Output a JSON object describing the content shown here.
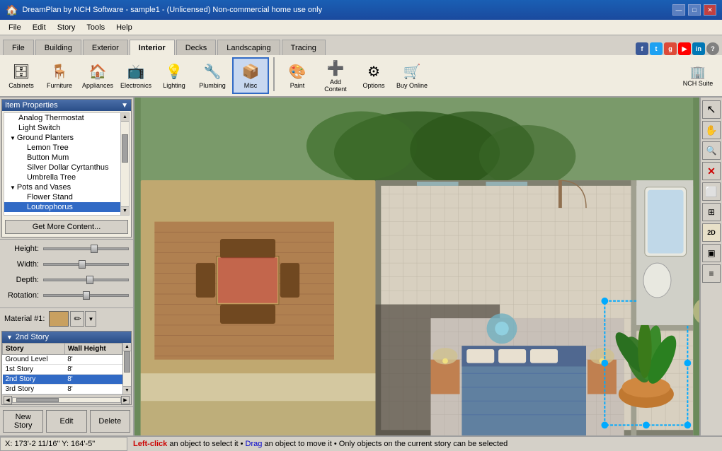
{
  "titlebar": {
    "title": "DreamPlan by NCH Software - sample1 - (Unlicensed) Non-commercial home use only",
    "app_icon": "🏠",
    "controls": [
      "—",
      "□",
      "✕"
    ]
  },
  "menubar": {
    "items": [
      "File",
      "Edit",
      "Story",
      "Tools",
      "Help"
    ]
  },
  "tabs": {
    "items": [
      "File",
      "Building",
      "Exterior",
      "Interior",
      "Decks",
      "Landscaping",
      "Tracing"
    ],
    "active": "Interior"
  },
  "toolbar": {
    "items": [
      {
        "icon": "🗄",
        "label": "Cabinets"
      },
      {
        "icon": "🪑",
        "label": "Furniture"
      },
      {
        "icon": "🏠",
        "label": "Appliances"
      },
      {
        "icon": "📺",
        "label": "Electronics"
      },
      {
        "icon": "💡",
        "label": "Lighting"
      },
      {
        "icon": "🔧",
        "label": "Plumbing"
      },
      {
        "icon": "📦",
        "label": "Misc"
      },
      {
        "icon": "🎨",
        "label": "Paint"
      },
      {
        "icon": "➕",
        "label": "Add Content"
      },
      {
        "icon": "⚙",
        "label": "Options"
      },
      {
        "icon": "🛒",
        "label": "Buy Online"
      }
    ],
    "active": "Misc",
    "nch_label": "NCH Suite"
  },
  "left_panel": {
    "header": "Item Properties",
    "tree": [
      {
        "label": "Analog Thermostat",
        "level": "level2",
        "id": "analog-thermostat"
      },
      {
        "label": "Light Switch",
        "level": "level2",
        "id": "light-switch"
      },
      {
        "label": "Ground Planters",
        "level": "level1 category",
        "id": "ground-planters"
      },
      {
        "label": "Lemon Tree",
        "level": "level3",
        "id": "lemon-tree"
      },
      {
        "label": "Button Mum",
        "level": "level3",
        "id": "button-mum"
      },
      {
        "label": "Silver Dollar Cyrtanthus",
        "level": "level3",
        "id": "silver-dollar"
      },
      {
        "label": "Umbrella Tree",
        "level": "level3",
        "id": "umbrella-tree"
      },
      {
        "label": "Pots and Vases",
        "level": "level1 category",
        "id": "pots-and-vases"
      },
      {
        "label": "Flower Stand",
        "level": "level3",
        "id": "flower-stand"
      },
      {
        "label": "Loutrophorus",
        "level": "level3",
        "id": "loutrophorus"
      }
    ],
    "get_more_btn": "Get More Content...",
    "sliders": [
      {
        "label": "Height:",
        "id": "height-slider"
      },
      {
        "label": "Width:",
        "id": "width-slider"
      },
      {
        "label": "Depth:",
        "id": "depth-slider"
      },
      {
        "label": "Rotation:",
        "id": "rotation-slider"
      }
    ],
    "material_label": "Material #1:"
  },
  "story_panel": {
    "header": "2nd Story",
    "columns": [
      "Story",
      "Wall Height"
    ],
    "rows": [
      {
        "story": "Ground Level",
        "height": "8'"
      },
      {
        "story": "1st Story",
        "height": "8'"
      },
      {
        "story": "2nd Story",
        "height": "8'"
      },
      {
        "story": "3rd Story",
        "height": "8'"
      }
    ],
    "selected_row": 2,
    "buttons": [
      "New Story",
      "Edit",
      "Delete"
    ]
  },
  "right_toolbar": {
    "buttons": [
      "👆",
      "✋",
      "🔍",
      "✕",
      "⬜",
      "🔲",
      "2D",
      "🔲",
      "≡"
    ]
  },
  "statusbar": {
    "coords": "X: 173'-2 11/16\"  Y: 164'-5\"",
    "message_parts": [
      {
        "text": "Left-click",
        "style": "red"
      },
      {
        "text": " an object to select it • ",
        "style": "normal"
      },
      {
        "text": "Drag",
        "style": "blue"
      },
      {
        "text": " an object to move it • Only objects on the current story can be selected",
        "style": "normal"
      }
    ]
  }
}
